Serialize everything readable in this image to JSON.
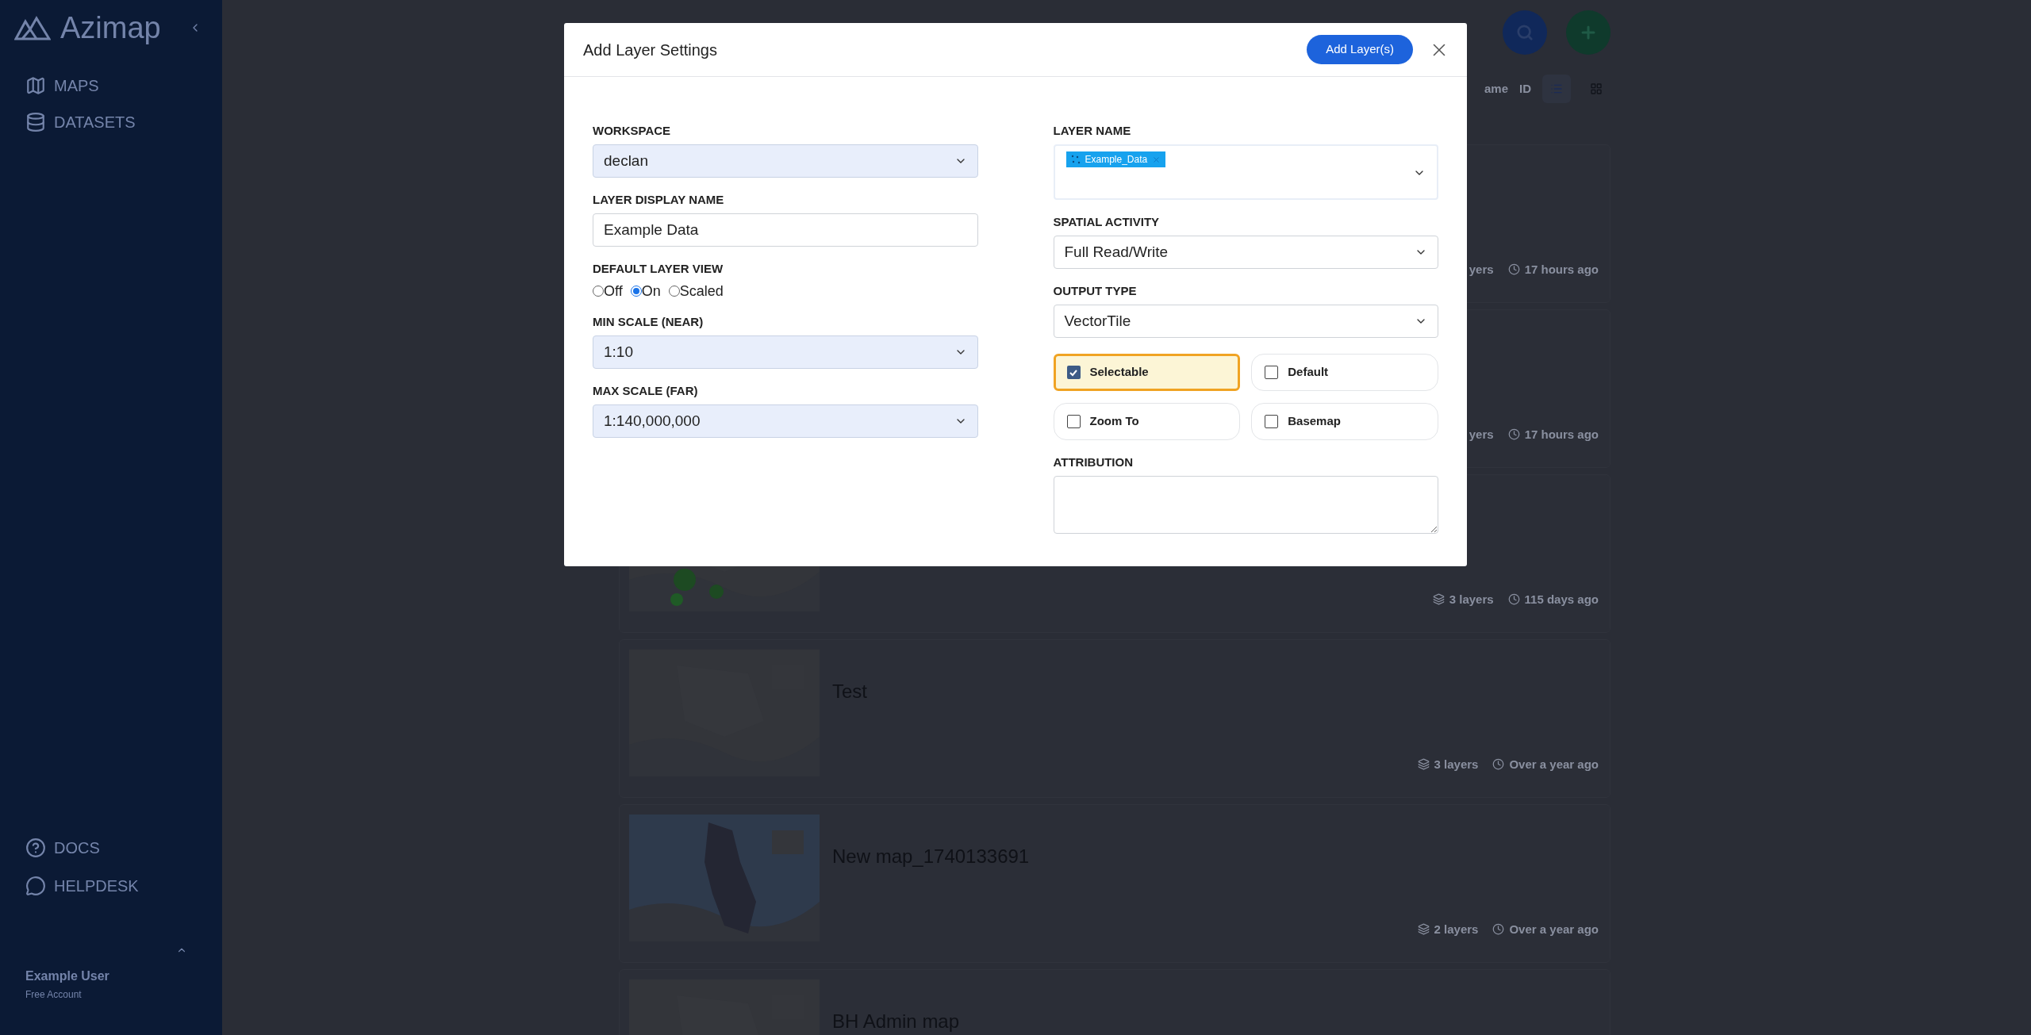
{
  "sidebar": {
    "brand": "Azimap",
    "nav": [
      {
        "label": "MAPS",
        "kind": "map"
      },
      {
        "label": "DATASETS",
        "kind": "database"
      }
    ],
    "footer_nav": [
      {
        "label": "DOCS",
        "kind": "help"
      },
      {
        "label": "HELPDESK",
        "kind": "chat"
      }
    ],
    "user": {
      "name": "Example User",
      "plan": "Free Account"
    }
  },
  "toolbar": {
    "sort_options": [
      {
        "label": "ame"
      },
      {
        "label": "ID"
      }
    ],
    "views": [
      {
        "kind": "list",
        "selected": true
      },
      {
        "kind": "grid",
        "selected": false
      }
    ]
  },
  "maps": [
    {
      "layers": "yers",
      "updated": "17 hours ago"
    },
    {
      "layers": "yers",
      "updated": "17 hours ago"
    },
    {
      "kind": "picture",
      "layers": "3 layers",
      "layers_icon": true,
      "updated": "115 days ago"
    },
    {
      "kind": "picture",
      "title": "Test",
      "layers": "3 layers",
      "layers_icon": true,
      "updated": "Over a year ago"
    },
    {
      "kind": "picture",
      "title": "New map_1740133691",
      "layers": "2 layers",
      "layers_icon": true,
      "updated": "Over a year ago"
    },
    {
      "kind": "picture",
      "title": "BH Admin map"
    }
  ],
  "dialog": {
    "title": "Add Layer Settings",
    "primary_button": "Add Layer(s)",
    "left": [
      {
        "kind": "select",
        "label": "WORKSPACE",
        "value": "declan"
      },
      {
        "kind": "input",
        "label": "LAYER DISPLAY NAME",
        "value": "Example Data"
      },
      {
        "kind": "radio",
        "label": "DEFAULT LAYER VIEW",
        "options": [
          {
            "label": "Off",
            "selected": false
          },
          {
            "label": "On",
            "selected": true
          },
          {
            "label": "Scaled",
            "selected": false
          }
        ]
      },
      {
        "kind": "select",
        "label": "MIN SCALE (NEAR)",
        "value": "1:10"
      },
      {
        "kind": "select",
        "label": "MAX SCALE (FAR)",
        "value": "1:140,000,000"
      }
    ],
    "right": [
      {
        "kind": "multiselect",
        "label": "LAYER NAME",
        "chips": [
          "Example_Data"
        ]
      },
      {
        "kind": "plain-select",
        "label": "SPATIAL ACTIVITY",
        "value": "Full Read/Write"
      },
      {
        "kind": "plain-select",
        "label": "OUTPUT TYPE",
        "value": "VectorTile"
      },
      {
        "kind": "checkboxes",
        "options": [
          {
            "label": "Selectable",
            "checked": true
          },
          {
            "label": "Default",
            "checked": false
          },
          {
            "label": "Zoom To",
            "checked": false
          },
          {
            "label": "Basemap",
            "checked": false
          }
        ]
      },
      {
        "kind": "textarea",
        "label": "ATTRIBUTION"
      }
    ]
  }
}
